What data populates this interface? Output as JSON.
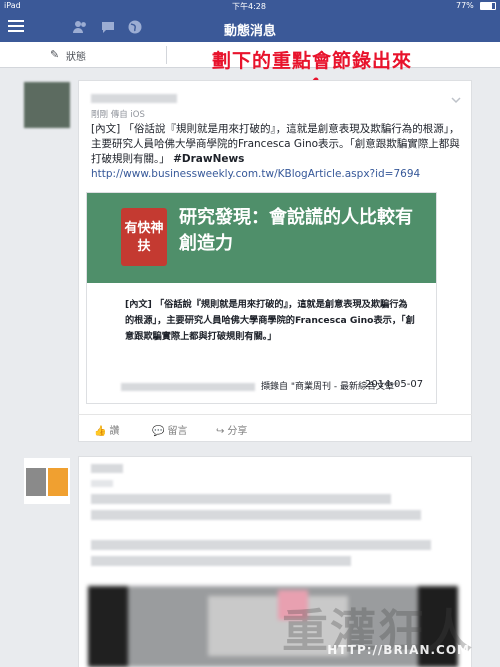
{
  "status_bar": {
    "carrier": "iPad",
    "time": "下午4:28",
    "battery": "77%"
  },
  "nav": {
    "title": "動態消息",
    "icons": [
      "menu-icon",
      "friends-icon",
      "messages-icon",
      "globe-icon"
    ]
  },
  "composer": {
    "status_label": "狀態"
  },
  "annotation": "劃下的重點會節錄出來",
  "post": {
    "meta": "剛剛 傳自 iOS",
    "text_prefix": "[內文] 「俗話說『規則就是用來打破的』，這就是創意表現及欺騙行為的根源」，主要研究人員哈佛大學商學院的Francesca Gino表示。「創意跟欺騙實際上都與打破規則有關。」",
    "hashtag": "#DrawNews",
    "link": "http://www.businessweekly.com.tw/KBlogArticle.aspx?id=7694",
    "shared": {
      "logo_text": "有快神扶",
      "headline": "研究發現：會說謊的人比較有創造力",
      "excerpt": "[內文] 「俗話說『規則就是用來打破的』，這就是創意表現及欺騙行為的根源」，主要研究人員哈佛大學商學院的Francesca Gino表示，「創意跟欺騙實際上都與打破規則有關。」",
      "source": "擷錄自 \"商業周刊 - 最新綜合文章\"",
      "date": "2014-05-07"
    },
    "actions": {
      "like": "讚",
      "comment": "留言",
      "share": "分享"
    }
  },
  "watermark": {
    "main": "重灌狂人",
    "sub": "HTTP://BRIAN.COM"
  },
  "colors": {
    "nav_bg": "#3b5998",
    "annotation": "#e8132c",
    "banner": "#4f8f6a"
  }
}
